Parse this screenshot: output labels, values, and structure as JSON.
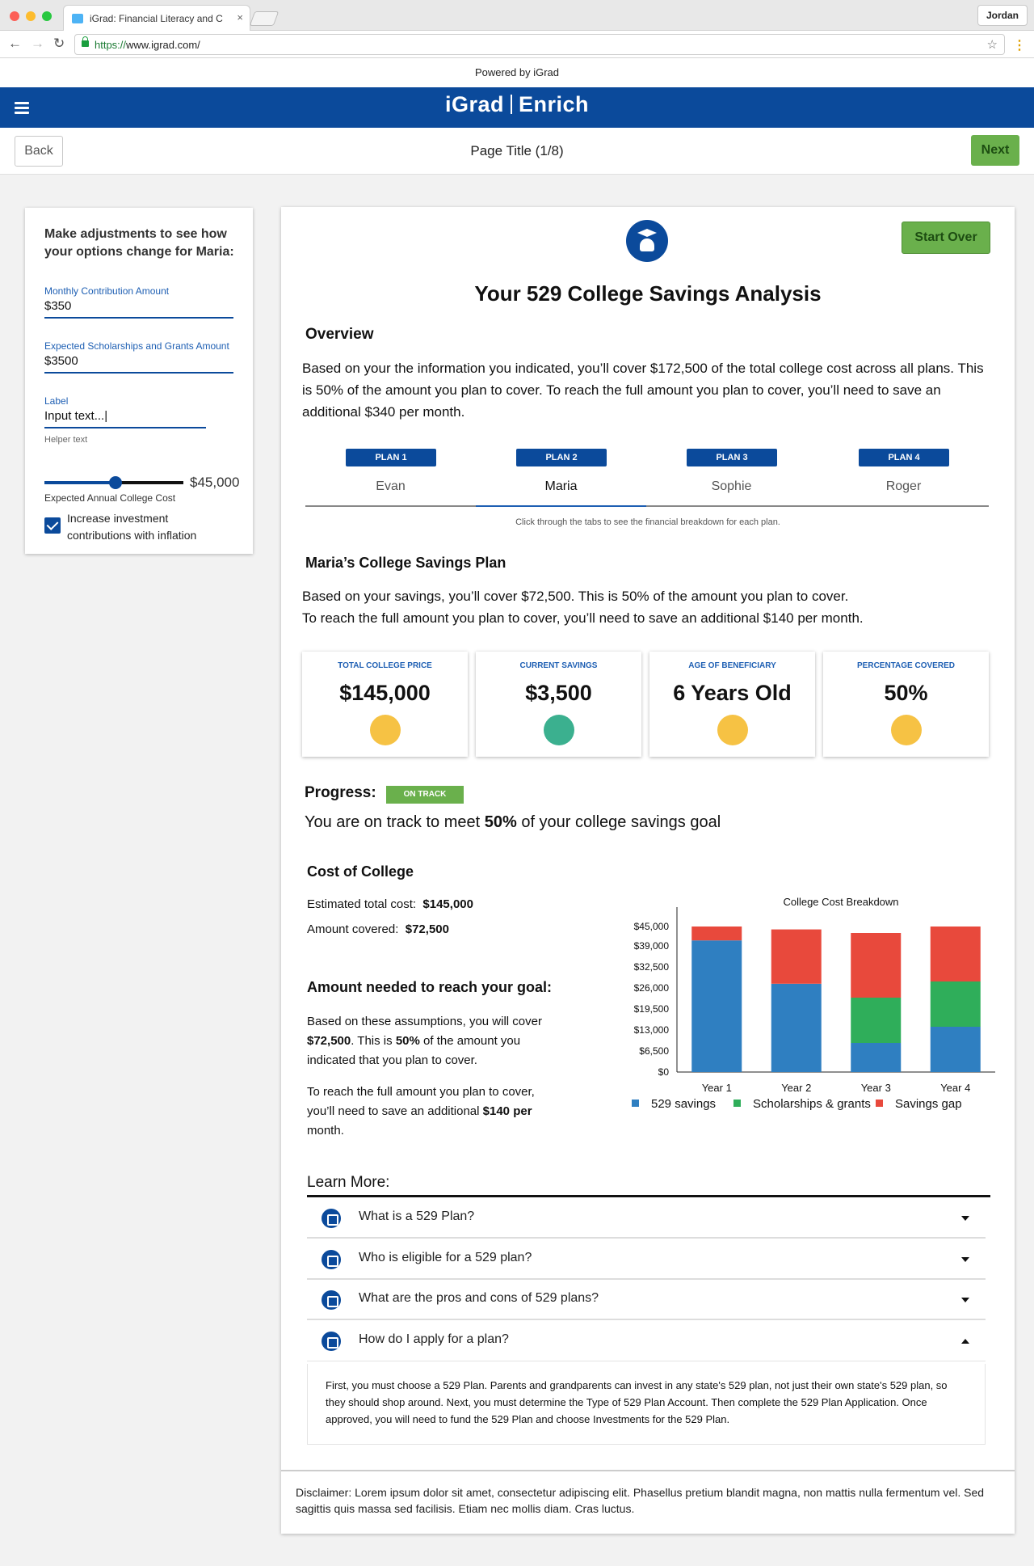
{
  "browser": {
    "tab_title": "iGrad: Financial Literacy and C",
    "url_scheme": "https://",
    "url_host": "www.igrad.com/",
    "user": "Jordan"
  },
  "powered_by": "Powered by iGrad",
  "brand": {
    "left": "iGrad",
    "right": "Enrich",
    "color": "#0b4a9b"
  },
  "header": {
    "back_label": "Back",
    "page_title": "Page Title (1/8)",
    "next_label": "Next"
  },
  "sidebar": {
    "intro": "Make adjustments to see how your options change for Maria:",
    "fields": [
      {
        "label": "Monthly Contribution Amount",
        "value": "$350"
      },
      {
        "label": "Expected Scholarships and Grants Amount",
        "value": "$3500"
      },
      {
        "label": "Label",
        "value": "Input text...|",
        "helper": "Helper text"
      }
    ],
    "slider": {
      "value": "$45,000",
      "label": "Expected Annual College Cost",
      "fraction": 0.51
    },
    "checkbox": {
      "checked": true,
      "label": "Increase investment contributions with inflation"
    }
  },
  "main": {
    "start_over": "Start Over",
    "title": "Your 529 College Savings Analysis",
    "overview_heading": "Overview",
    "overview_text": "Based on your the information you indicated, you’ll cover $172,500 of the total college cost across all plans. This is 50% of the amount you plan to cover.  To reach the full amount you plan to cover, you’ll need to save an additional $340 per month.",
    "plans": [
      {
        "pill": "PLAN 1",
        "name": "Evan"
      },
      {
        "pill": "PLAN 2",
        "name": "Maria",
        "active": true
      },
      {
        "pill": "PLAN 3",
        "name": "Sophie"
      },
      {
        "pill": "PLAN 4",
        "name": "Roger"
      }
    ],
    "tab_hint": "Click through the tabs to see the financial breakdown for each plan.",
    "plan_heading": "Maria’s College Savings Plan",
    "plan_text_1": "Based on your savings, you’ll cover $72,500. This is 50% of the amount you plan to cover.",
    "plan_text_2": "To reach the full amount you plan to cover, you’ll need to save an additional $140 per month.",
    "stats": [
      {
        "label": "TOTAL COLLEGE PRICE",
        "value": "$145,000",
        "icon": "graduation-dollar-icon",
        "icon_color": "#f6c244"
      },
      {
        "label": "CURRENT SAVINGS",
        "value": "$3,500",
        "icon": "piggy-bank-icon",
        "icon_color": "#3bb08f"
      },
      {
        "label": "AGE OF BENEFICIARY",
        "value": "6 Years Old",
        "icon": "graduate-person-icon",
        "icon_color": "#f6c244"
      },
      {
        "label": "PERCENTAGE COVERED",
        "value": "50%",
        "icon": "percent-hand-icon",
        "icon_color": "#f6c244"
      }
    ],
    "progress_label": "Progress:",
    "progress_badge": "ON TRACK",
    "progress_text_pre": "You are on track to meet ",
    "progress_text_bold": "50%",
    "progress_text_post": " of your college savings goal",
    "cost_heading": "Cost of College",
    "est_label": "Estimated total cost:",
    "est_value": "$145,000",
    "covered_label": "Amount covered:",
    "covered_value": "$72,500",
    "goal_heading": "Amount needed to reach your goal:",
    "goal_p1_a": "Based on these assumptions, you will cover ",
    "goal_p1_b": "$72,500",
    "goal_p1_c": ". This is ",
    "goal_p1_d": "50%",
    "goal_p1_e": " of the amount you indicated that you plan to cover.",
    "goal_p2_a": "To reach the full amount you plan to cover, you’ll need to save an additional ",
    "goal_p2_b": "$140 per",
    "goal_p2_c": " month.",
    "learn_more": "Learn More:",
    "faqs": [
      {
        "q": "What is a 529 Plan?",
        "icon": "piggy-gauge-icon",
        "open": false
      },
      {
        "q": "Who is eligible for a 529 plan?",
        "icon": "tag-dollar-icon",
        "open": false
      },
      {
        "q": "What are the pros and cons of 529 plans?",
        "icon": "tag-dollar-icon",
        "open": false
      },
      {
        "q": "How do I apply for a plan?",
        "icon": "document-list-icon",
        "open": true
      }
    ],
    "faq_answer": "First, you must choose a 529 Plan. Parents and grandparents can invest in any state's 529 plan, not just their own state's 529 plan, so they should shop around. Next, you must determine the Type of 529 Plan Account. Then complete the 529 Plan Application. Once approved, you will need to fund the 529 Plan and choose Investments for the 529 Plan.",
    "disclaimer": "Disclaimer: Lorem ipsum dolor sit amet, consectetur adipiscing elit. Phasellus pretium blandit magna, non mattis nulla fermentum vel. Sed sagittis quis massa sed facilisis. Etiam nec mollis diam. Cras luctus."
  },
  "chart_data": {
    "type": "bar",
    "stacked": true,
    "title": "College Cost Breakdown",
    "categories": [
      "Year 1",
      "Year 2",
      "Year 3",
      "Year 4"
    ],
    "series": [
      {
        "name": "529 savings",
        "color": "#2f7fc1",
        "values": [
          40700,
          27300,
          9000,
          14000
        ]
      },
      {
        "name": "Scholarships & grants",
        "color": "#2fae5a",
        "values": [
          0,
          0,
          14000,
          14000
        ]
      },
      {
        "name": "Savings gap",
        "color": "#e8493c",
        "values": [
          4300,
          16800,
          20000,
          17000
        ]
      }
    ],
    "yticks": [
      "$0",
      "$6,500",
      "$13,000",
      "$19,500",
      "$26,000",
      "$32,500",
      "$39,000",
      "$45,000"
    ],
    "ytick_values": [
      0,
      6500,
      13000,
      19500,
      26000,
      32500,
      39000,
      45000
    ],
    "ylim": [
      0,
      48500
    ],
    "legend": "bottom"
  }
}
